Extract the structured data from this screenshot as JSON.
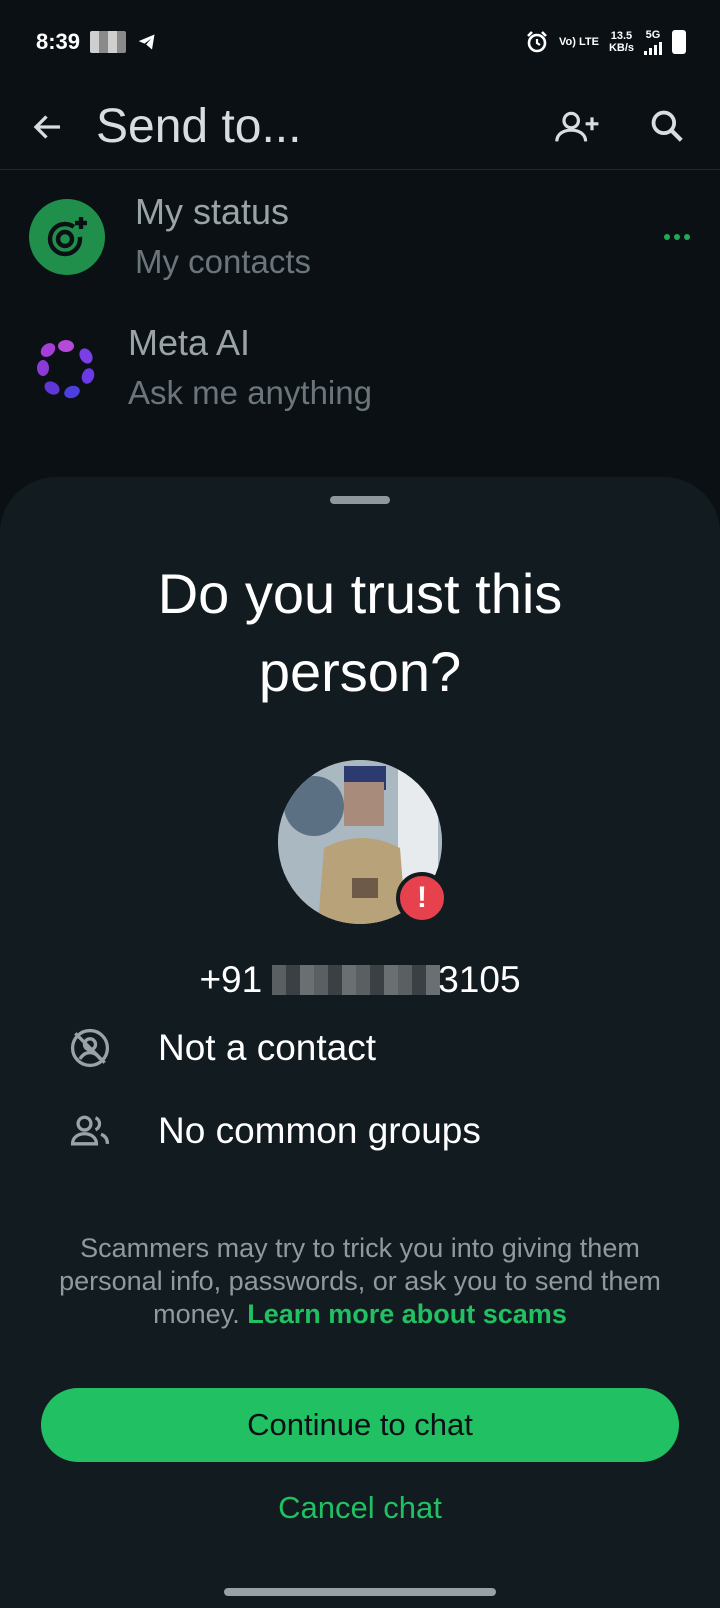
{
  "status_bar": {
    "time": "8:39",
    "volte": "Vo) LTE",
    "speed_value": "13.5",
    "speed_unit": "KB/s",
    "network": "5G"
  },
  "app_bar": {
    "title": "Send to...",
    "icons": [
      "arrow-left-icon",
      "add-contact-icon",
      "search-icon"
    ]
  },
  "list": [
    {
      "title": "My status",
      "subtitle": "My contacts"
    },
    {
      "title": "Meta AI",
      "subtitle": "Ask me anything"
    }
  ],
  "sheet": {
    "title": "Do you trust this person?",
    "phone_prefix": "+91",
    "phone_suffix": "3105",
    "info": [
      {
        "icon": "no-contact-icon",
        "text": "Not a contact"
      },
      {
        "icon": "group-icon",
        "text": "No common groups"
      }
    ],
    "warning_text": "Scammers may try to trick you into giving them personal info, passwords, or ask you to send them money.",
    "learn_more": "Learn more about scams",
    "continue_label": "Continue to chat",
    "cancel_label": "Cancel chat"
  },
  "colors": {
    "accent": "#21c063",
    "background": "#0b1014",
    "sheet": "#121b20",
    "danger": "#e8414e"
  }
}
